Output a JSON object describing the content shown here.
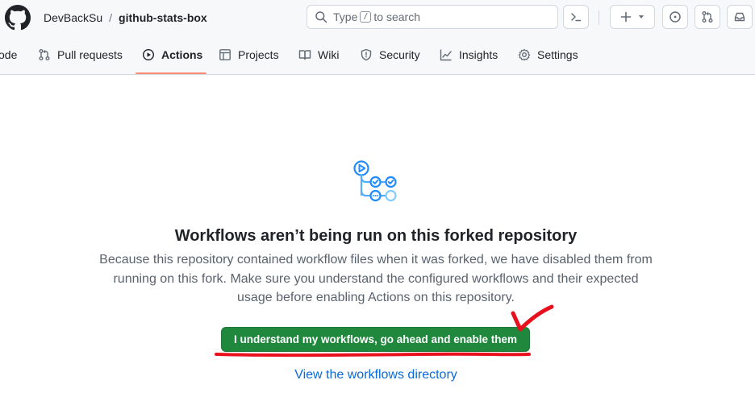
{
  "header": {
    "owner": "DevBackSu",
    "separator": "/",
    "repo": "github-stats-box",
    "search": {
      "prefix": "Type",
      "key": "/",
      "suffix": "to search"
    }
  },
  "nav": {
    "tabs": [
      {
        "label": "ode",
        "icon": "code-icon"
      },
      {
        "label": "Pull requests",
        "icon": "git-pull-request-icon"
      },
      {
        "label": "Actions",
        "icon": "play-icon",
        "active": true
      },
      {
        "label": "Projects",
        "icon": "table-icon"
      },
      {
        "label": "Wiki",
        "icon": "book-icon"
      },
      {
        "label": "Security",
        "icon": "shield-icon"
      },
      {
        "label": "Insights",
        "icon": "graph-icon"
      },
      {
        "label": "Settings",
        "icon": "gear-icon"
      }
    ]
  },
  "main": {
    "title": "Workflows aren’t being run on this forked repository",
    "description": "Because this repository contained workflow files when it was forked, we have disabled them from running on this fork. Make sure you understand the configured workflows and their expected usage before enabling Actions on this repository.",
    "enable_button": "I understand my workflows, go ahead and enable them",
    "view_link": "View the workflows directory"
  },
  "colors": {
    "accent_green": "#1f883d",
    "link_blue": "#0969da",
    "tab_underline": "#fd8c73",
    "annotation_red": "#e8101c"
  }
}
